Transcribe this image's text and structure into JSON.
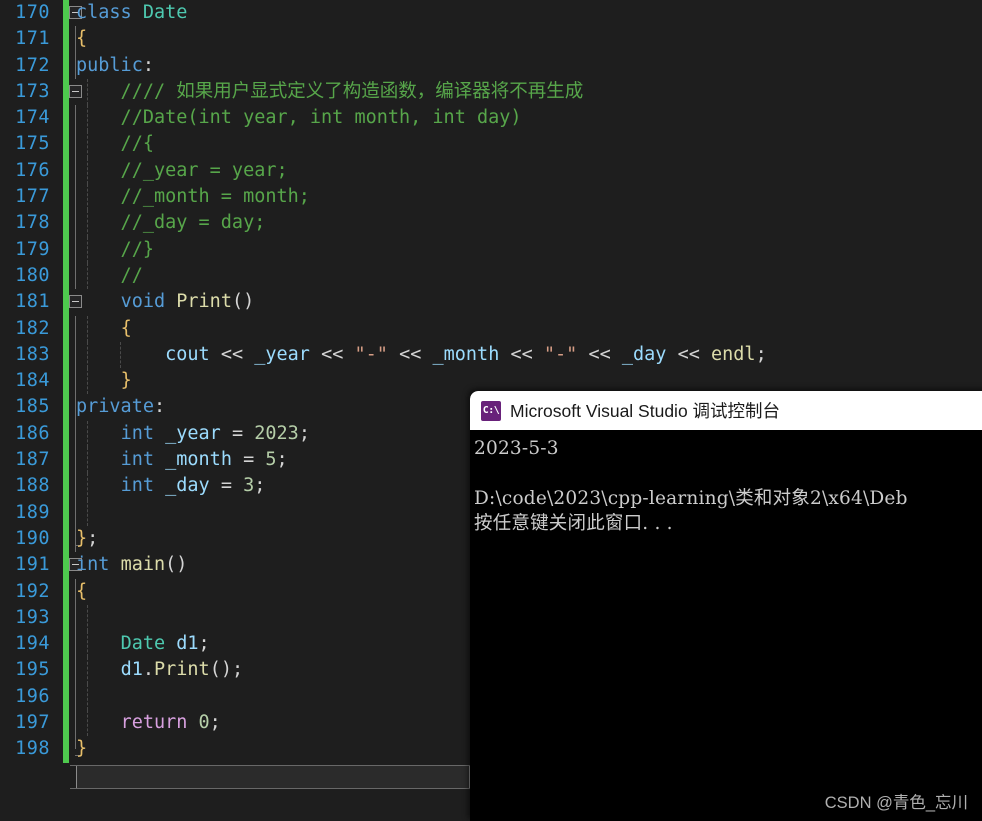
{
  "editor": {
    "theme": "vs-dark",
    "background": "#1e1e1e",
    "line_number_color": "#3a9ad9",
    "change_bar_color": "#4ec94e",
    "first_line_number": 170,
    "lines": [
      {
        "n": "170",
        "text": "class Date"
      },
      {
        "n": "171",
        "text": "{"
      },
      {
        "n": "172",
        "text": "public:"
      },
      {
        "n": "173",
        "text": "    //// 如果用户显式定义了构造函数，编译器将不再生成"
      },
      {
        "n": "174",
        "text": "    //Date(int year, int month, int day)"
      },
      {
        "n": "175",
        "text": "    //{"
      },
      {
        "n": "176",
        "text": "    //_year = year;"
      },
      {
        "n": "177",
        "text": "    //_month = month;"
      },
      {
        "n": "178",
        "text": "    //_day = day;"
      },
      {
        "n": "179",
        "text": "    //}"
      },
      {
        "n": "180",
        "text": "    //"
      },
      {
        "n": "181",
        "text": "    void Print()"
      },
      {
        "n": "182",
        "text": "    {"
      },
      {
        "n": "183",
        "text": "        cout << _year << \"-\" << _month << \"-\" << _day << endl;"
      },
      {
        "n": "184",
        "text": "    }"
      },
      {
        "n": "185",
        "text": "private:"
      },
      {
        "n": "186",
        "text": "    int _year = 2023;"
      },
      {
        "n": "187",
        "text": "    int _month = 5;"
      },
      {
        "n": "188",
        "text": "    int _day = 3;"
      },
      {
        "n": "189",
        "text": ""
      },
      {
        "n": "190",
        "text": "};"
      },
      {
        "n": "191",
        "text": "int main()"
      },
      {
        "n": "192",
        "text": "{"
      },
      {
        "n": "193",
        "text": ""
      },
      {
        "n": "194",
        "text": "    Date d1;"
      },
      {
        "n": "195",
        "text": "    d1.Print();"
      },
      {
        "n": "196",
        "text": ""
      },
      {
        "n": "197",
        "text": "    return 0;"
      },
      {
        "n": "198",
        "text": "}"
      }
    ]
  },
  "console": {
    "title": "Microsoft Visual Studio 调试控制台",
    "icon": "cmd-prompt-icon",
    "icon_glyph": "C:\\",
    "icon_color": "#68217a",
    "background": "#000000",
    "text_color": "#cccccc",
    "output_lines": [
      "2023-5-3",
      "",
      "D:\\code\\2023\\cpp-learning\\类和对象2\\x64\\Deb",
      "按任意键关闭此窗口. . ."
    ]
  },
  "watermark": {
    "text": "CSDN @青色_忘川"
  }
}
